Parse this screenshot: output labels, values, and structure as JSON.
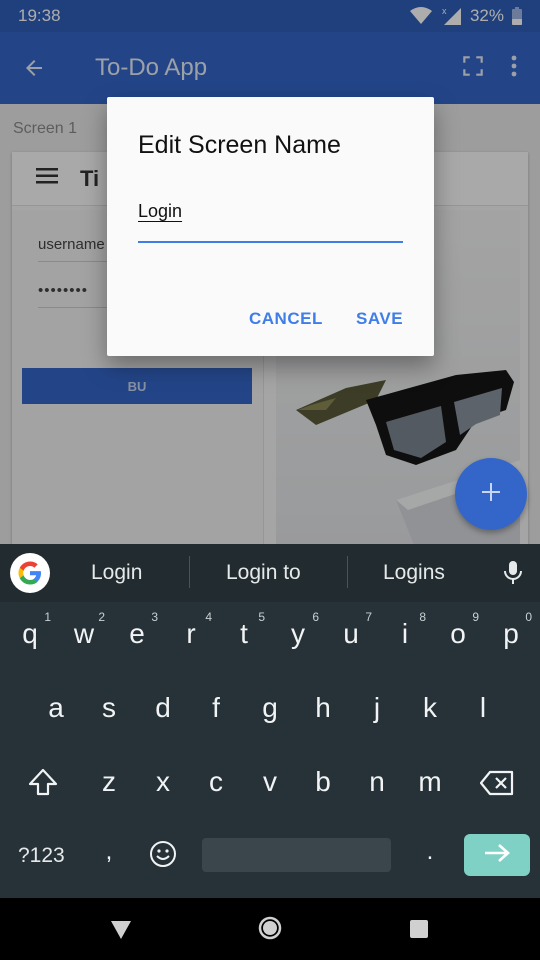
{
  "status_bar": {
    "time": "19:38",
    "battery": "32%"
  },
  "app_bar": {
    "title": "To-Do App"
  },
  "background": {
    "screen_label": "Screen 1",
    "card_title": "Ti",
    "username_placeholder": "username",
    "password_value": "••••••••",
    "button_label": "BU"
  },
  "dialog": {
    "title": "Edit Screen Name",
    "input_value": "Login",
    "cancel_label": "CANCEL",
    "save_label": "SAVE"
  },
  "keyboard": {
    "suggestions": [
      "Login",
      "Login to",
      "Logins"
    ],
    "row1": [
      {
        "k": "q",
        "n": "1"
      },
      {
        "k": "w",
        "n": "2"
      },
      {
        "k": "e",
        "n": "3"
      },
      {
        "k": "r",
        "n": "4"
      },
      {
        "k": "t",
        "n": "5"
      },
      {
        "k": "y",
        "n": "6"
      },
      {
        "k": "u",
        "n": "7"
      },
      {
        "k": "i",
        "n": "8"
      },
      {
        "k": "o",
        "n": "9"
      },
      {
        "k": "p",
        "n": "0"
      }
    ],
    "row2": [
      "a",
      "s",
      "d",
      "f",
      "g",
      "h",
      "j",
      "k",
      "l"
    ],
    "row3": [
      "z",
      "x",
      "c",
      "v",
      "b",
      "n",
      "m"
    ],
    "symbols_label": "?123",
    "comma": ",",
    "period": "."
  },
  "colors": {
    "primary": "#3466c9",
    "accent": "#3f7ee8",
    "keyboard_bg": "#263238",
    "enter": "#7fd1c6"
  }
}
